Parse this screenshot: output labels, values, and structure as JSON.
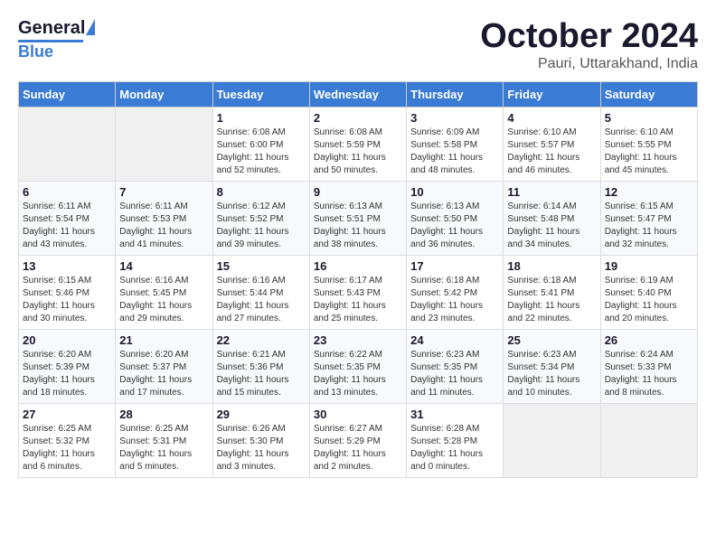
{
  "header": {
    "logo_general": "General",
    "logo_blue": "Blue",
    "month": "October 2024",
    "location": "Pauri, Uttarakhand, India"
  },
  "weekdays": [
    "Sunday",
    "Monday",
    "Tuesday",
    "Wednesday",
    "Thursday",
    "Friday",
    "Saturday"
  ],
  "weeks": [
    [
      {
        "day": "",
        "info": ""
      },
      {
        "day": "",
        "info": ""
      },
      {
        "day": "1",
        "info": "Sunrise: 6:08 AM\nSunset: 6:00 PM\nDaylight: 11 hours\nand 52 minutes."
      },
      {
        "day": "2",
        "info": "Sunrise: 6:08 AM\nSunset: 5:59 PM\nDaylight: 11 hours\nand 50 minutes."
      },
      {
        "day": "3",
        "info": "Sunrise: 6:09 AM\nSunset: 5:58 PM\nDaylight: 11 hours\nand 48 minutes."
      },
      {
        "day": "4",
        "info": "Sunrise: 6:10 AM\nSunset: 5:57 PM\nDaylight: 11 hours\nand 46 minutes."
      },
      {
        "day": "5",
        "info": "Sunrise: 6:10 AM\nSunset: 5:55 PM\nDaylight: 11 hours\nand 45 minutes."
      }
    ],
    [
      {
        "day": "6",
        "info": "Sunrise: 6:11 AM\nSunset: 5:54 PM\nDaylight: 11 hours\nand 43 minutes."
      },
      {
        "day": "7",
        "info": "Sunrise: 6:11 AM\nSunset: 5:53 PM\nDaylight: 11 hours\nand 41 minutes."
      },
      {
        "day": "8",
        "info": "Sunrise: 6:12 AM\nSunset: 5:52 PM\nDaylight: 11 hours\nand 39 minutes."
      },
      {
        "day": "9",
        "info": "Sunrise: 6:13 AM\nSunset: 5:51 PM\nDaylight: 11 hours\nand 38 minutes."
      },
      {
        "day": "10",
        "info": "Sunrise: 6:13 AM\nSunset: 5:50 PM\nDaylight: 11 hours\nand 36 minutes."
      },
      {
        "day": "11",
        "info": "Sunrise: 6:14 AM\nSunset: 5:48 PM\nDaylight: 11 hours\nand 34 minutes."
      },
      {
        "day": "12",
        "info": "Sunrise: 6:15 AM\nSunset: 5:47 PM\nDaylight: 11 hours\nand 32 minutes."
      }
    ],
    [
      {
        "day": "13",
        "info": "Sunrise: 6:15 AM\nSunset: 5:46 PM\nDaylight: 11 hours\nand 30 minutes."
      },
      {
        "day": "14",
        "info": "Sunrise: 6:16 AM\nSunset: 5:45 PM\nDaylight: 11 hours\nand 29 minutes."
      },
      {
        "day": "15",
        "info": "Sunrise: 6:16 AM\nSunset: 5:44 PM\nDaylight: 11 hours\nand 27 minutes."
      },
      {
        "day": "16",
        "info": "Sunrise: 6:17 AM\nSunset: 5:43 PM\nDaylight: 11 hours\nand 25 minutes."
      },
      {
        "day": "17",
        "info": "Sunrise: 6:18 AM\nSunset: 5:42 PM\nDaylight: 11 hours\nand 23 minutes."
      },
      {
        "day": "18",
        "info": "Sunrise: 6:18 AM\nSunset: 5:41 PM\nDaylight: 11 hours\nand 22 minutes."
      },
      {
        "day": "19",
        "info": "Sunrise: 6:19 AM\nSunset: 5:40 PM\nDaylight: 11 hours\nand 20 minutes."
      }
    ],
    [
      {
        "day": "20",
        "info": "Sunrise: 6:20 AM\nSunset: 5:39 PM\nDaylight: 11 hours\nand 18 minutes."
      },
      {
        "day": "21",
        "info": "Sunrise: 6:20 AM\nSunset: 5:37 PM\nDaylight: 11 hours\nand 17 minutes."
      },
      {
        "day": "22",
        "info": "Sunrise: 6:21 AM\nSunset: 5:36 PM\nDaylight: 11 hours\nand 15 minutes."
      },
      {
        "day": "23",
        "info": "Sunrise: 6:22 AM\nSunset: 5:35 PM\nDaylight: 11 hours\nand 13 minutes."
      },
      {
        "day": "24",
        "info": "Sunrise: 6:23 AM\nSunset: 5:35 PM\nDaylight: 11 hours\nand 11 minutes."
      },
      {
        "day": "25",
        "info": "Sunrise: 6:23 AM\nSunset: 5:34 PM\nDaylight: 11 hours\nand 10 minutes."
      },
      {
        "day": "26",
        "info": "Sunrise: 6:24 AM\nSunset: 5:33 PM\nDaylight: 11 hours\nand 8 minutes."
      }
    ],
    [
      {
        "day": "27",
        "info": "Sunrise: 6:25 AM\nSunset: 5:32 PM\nDaylight: 11 hours\nand 6 minutes."
      },
      {
        "day": "28",
        "info": "Sunrise: 6:25 AM\nSunset: 5:31 PM\nDaylight: 11 hours\nand 5 minutes."
      },
      {
        "day": "29",
        "info": "Sunrise: 6:26 AM\nSunset: 5:30 PM\nDaylight: 11 hours\nand 3 minutes."
      },
      {
        "day": "30",
        "info": "Sunrise: 6:27 AM\nSunset: 5:29 PM\nDaylight: 11 hours\nand 2 minutes."
      },
      {
        "day": "31",
        "info": "Sunrise: 6:28 AM\nSunset: 5:28 PM\nDaylight: 11 hours\nand 0 minutes."
      },
      {
        "day": "",
        "info": ""
      },
      {
        "day": "",
        "info": ""
      }
    ]
  ]
}
